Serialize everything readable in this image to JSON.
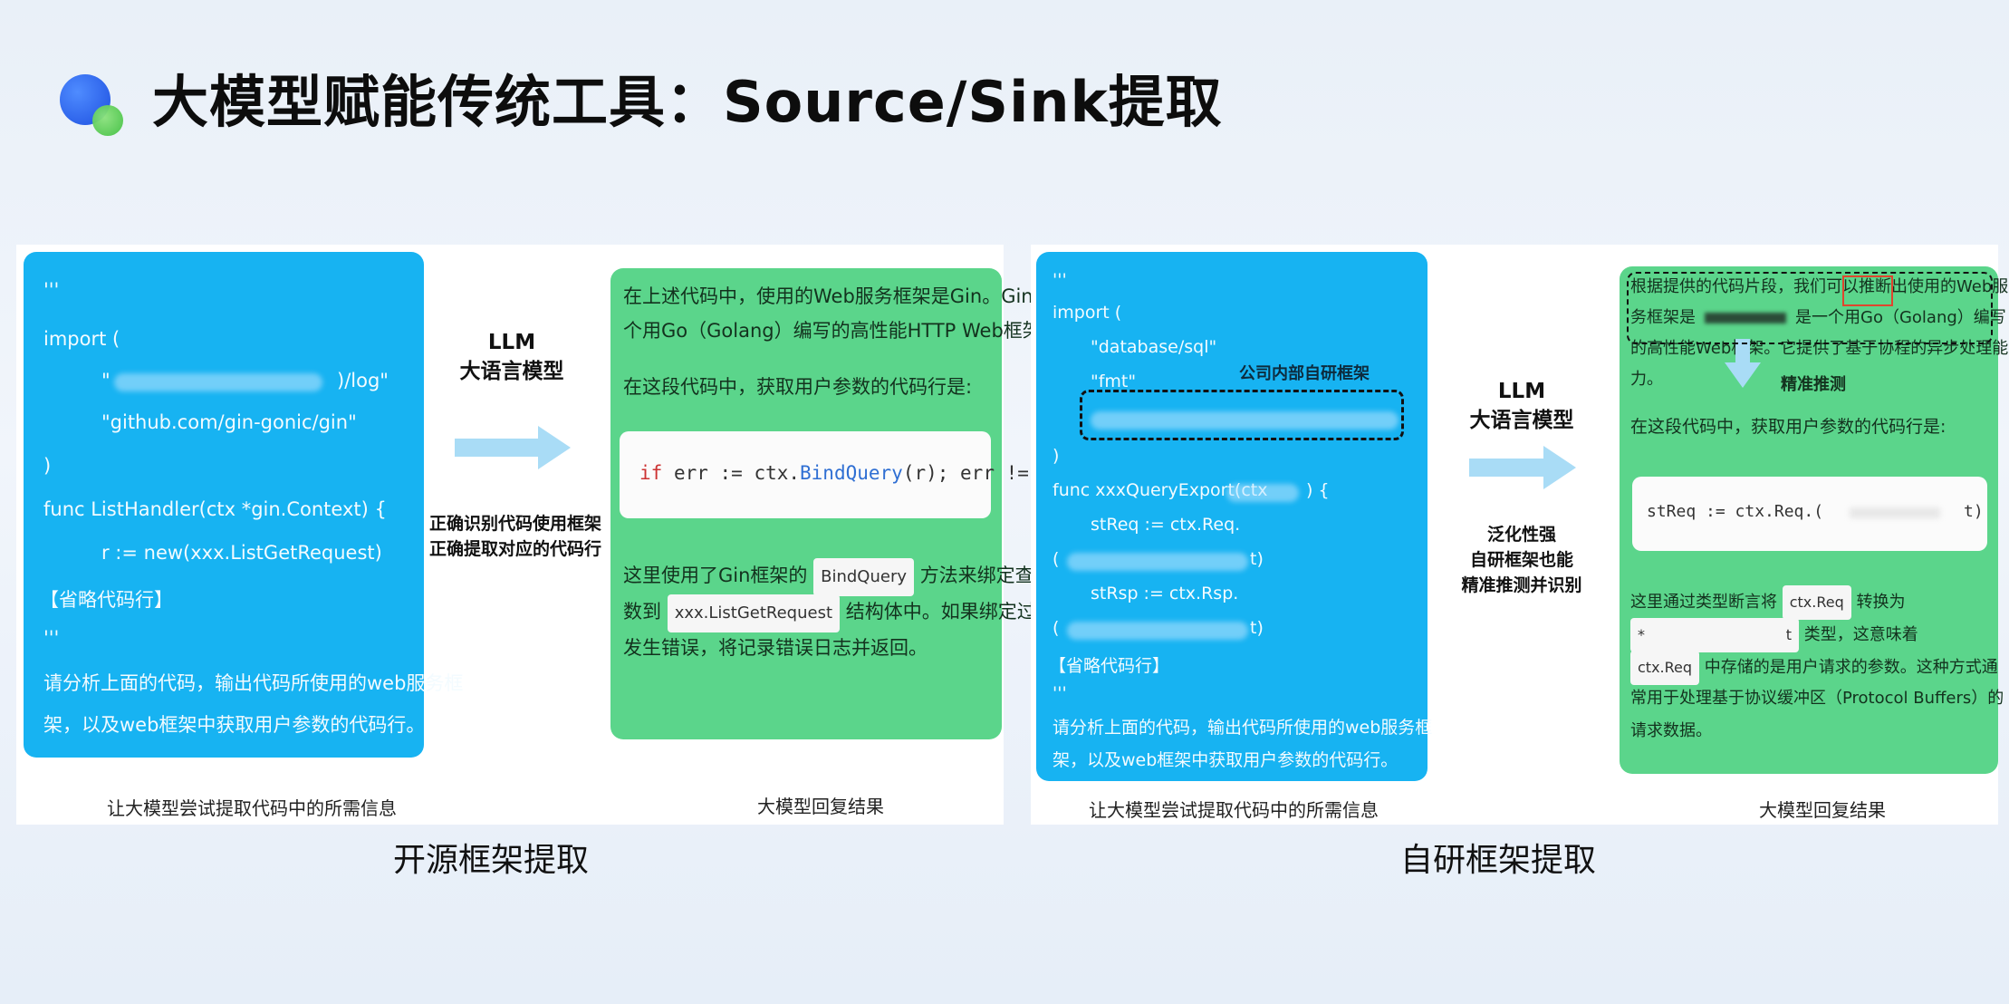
{
  "title": "大模型赋能传统工具：Source/Sink提取",
  "colors": {
    "blue": "#17b3f2",
    "green": "#5bd58b",
    "arrow": "#a9dcf6"
  },
  "left": {
    "code_lines": [
      "'''",
      "import (",
      "\"",
      ")/log\"",
      "\"github.com/gin-gonic/gin\"",
      ")",
      "func ListHandler(ctx *gin.Context) {",
      "r := new(xxx.ListGetRequest)",
      "【省略代码行】",
      "'''",
      "请分析上面的代码，输出代码所使用的web服务框",
      "架，以及web框架中获取用户参数的代码行。"
    ],
    "llm": {
      "line1": "LLM",
      "line2": "大语言模型"
    },
    "note": {
      "line1": "正确识别代码使用框架",
      "line2": "正确提取对应的代码行"
    },
    "reply": {
      "p1a": "在上述代码中，使用的Web服务框架是Gin。Gin是一",
      "p1b": "个用Go（Golang）编写的高性能HTTP Web框架。",
      "p2": "在这段代码中，获取用户参数的代码行是:",
      "code": {
        "kw": "if",
        "a": " err := ctx.",
        "fn": "BindQuery",
        "b": "(r); err != nil {"
      },
      "p3a": "这里使用了Gin框架的",
      "chip1": "BindQuery",
      "p3b": "方法来绑定查询参",
      "p3c": "数到",
      "chip2": "xxx.ListGetRequest",
      "p3d": "结构体中。如果绑定过程中",
      "p3e": "发生错误，将记录错误日志并返回。"
    },
    "caption_input": "让大模型尝试提取代码中的所需信息",
    "caption_output": "大模型回复结果"
  },
  "right": {
    "code_lines": [
      "'''",
      "import (",
      "\"database/sql\"",
      "\"fmt\"",
      ")",
      "func xxxQueryExport(ctx",
      ") {",
      "stReq := ctx.Req.",
      "(",
      "t)",
      "stRsp := ctx.Rsp.",
      "(",
      "t)",
      "【省略代码行】",
      "'''",
      "请分析上面的代码，输出代码所使用的web服务框",
      "架，以及web框架中获取用户参数的代码行。"
    ],
    "internal_label": "公司内部自研框架",
    "llm": {
      "line1": "LLM",
      "line2": "大语言模型"
    },
    "note": {
      "line1": "泛化性强",
      "line2": "自研框架也能",
      "line3": "精准推测并识别"
    },
    "reply": {
      "p1a": "根据提供的代码片段，我们可以推断出使用的Web服",
      "p1b": "务框架是",
      "p1c": "是一个用Go（Golang）编写",
      "p1d": "的高性能Web框架。它提供了基于协程的异步处理能",
      "p1e": "力。",
      "infer_label": "精准推测",
      "p2": "在这段代码中，获取用户参数的代码行是:",
      "code_a": "stReq := ctx.Req.(",
      "code_b": "t)",
      "p3a": "这里通过类型断言将",
      "chip1": "ctx.Req",
      "p3b": "转换为",
      "p3c": "*",
      "p3d": "t",
      "p3e": "类型，这意味着",
      "chip2": "ctx.Req",
      "p3f": "中存储的是用户请求的参数。这种方式通",
      "p3g": "常用于处理基于协议缓冲区（Protocol Buffers）的",
      "p3h": "请求数据。"
    },
    "caption_input": "让大模型尝试提取代码中的所需信息",
    "caption_output": "大模型回复结果"
  },
  "section_left": "开源框架提取",
  "section_right": "自研框架提取"
}
